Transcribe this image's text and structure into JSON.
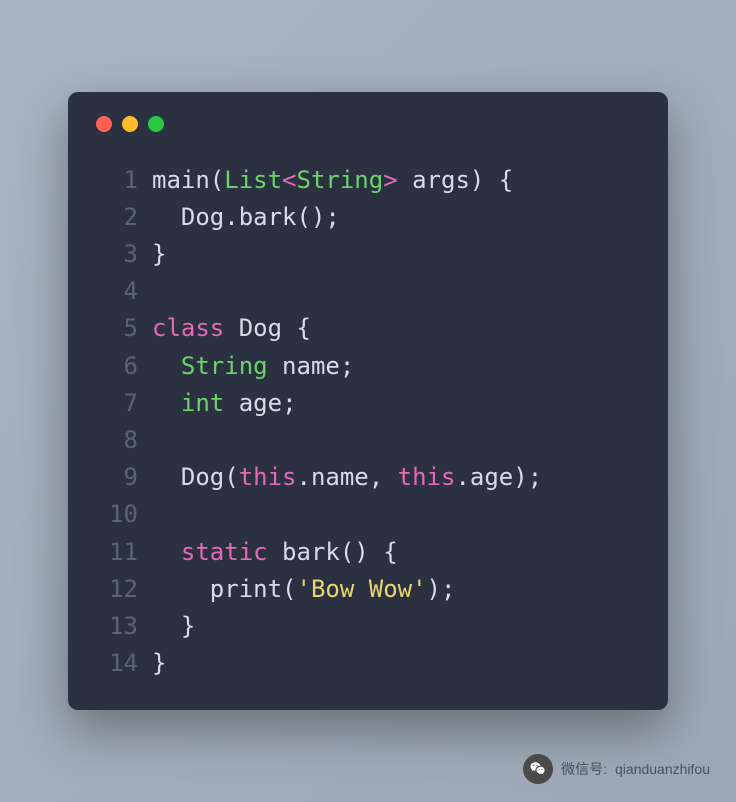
{
  "window": {
    "controls": {
      "close_color": "#ff5f56",
      "minimize_color": "#ffbd2e",
      "zoom_color": "#27c93f"
    }
  },
  "code": {
    "lines": [
      {
        "num": "1",
        "tokens": [
          {
            "t": "main(",
            "c": "plain"
          },
          {
            "t": "List",
            "c": "type"
          },
          {
            "t": "<",
            "c": "kw"
          },
          {
            "t": "String",
            "c": "type"
          },
          {
            "t": ">",
            "c": "kw"
          },
          {
            "t": " args) {",
            "c": "plain"
          }
        ]
      },
      {
        "num": "2",
        "tokens": [
          {
            "t": "  Dog.bark();",
            "c": "plain"
          }
        ]
      },
      {
        "num": "3",
        "tokens": [
          {
            "t": "}",
            "c": "plain"
          }
        ]
      },
      {
        "num": "4",
        "tokens": []
      },
      {
        "num": "5",
        "tokens": [
          {
            "t": "class",
            "c": "kw"
          },
          {
            "t": " Dog {",
            "c": "plain"
          }
        ]
      },
      {
        "num": "6",
        "tokens": [
          {
            "t": "  ",
            "c": "plain"
          },
          {
            "t": "String",
            "c": "type"
          },
          {
            "t": " name;",
            "c": "plain"
          }
        ]
      },
      {
        "num": "7",
        "tokens": [
          {
            "t": "  ",
            "c": "plain"
          },
          {
            "t": "int",
            "c": "type"
          },
          {
            "t": " age;",
            "c": "plain"
          }
        ]
      },
      {
        "num": "8",
        "tokens": []
      },
      {
        "num": "9",
        "tokens": [
          {
            "t": "  Dog(",
            "c": "plain"
          },
          {
            "t": "this",
            "c": "kw"
          },
          {
            "t": ".name, ",
            "c": "plain"
          },
          {
            "t": "this",
            "c": "kw"
          },
          {
            "t": ".age);",
            "c": "plain"
          }
        ]
      },
      {
        "num": "10",
        "tokens": []
      },
      {
        "num": "11",
        "tokens": [
          {
            "t": "  ",
            "c": "plain"
          },
          {
            "t": "static",
            "c": "kw"
          },
          {
            "t": " bark() {",
            "c": "plain"
          }
        ]
      },
      {
        "num": "12",
        "tokens": [
          {
            "t": "    print(",
            "c": "plain"
          },
          {
            "t": "'Bow Wow'",
            "c": "str"
          },
          {
            "t": ");",
            "c": "plain"
          }
        ]
      },
      {
        "num": "13",
        "tokens": [
          {
            "t": "  }",
            "c": "plain"
          }
        ]
      },
      {
        "num": "14",
        "tokens": [
          {
            "t": "}",
            "c": "plain"
          }
        ]
      }
    ]
  },
  "attribution": {
    "label": "微信号:",
    "handle": "qianduanzhifou"
  }
}
